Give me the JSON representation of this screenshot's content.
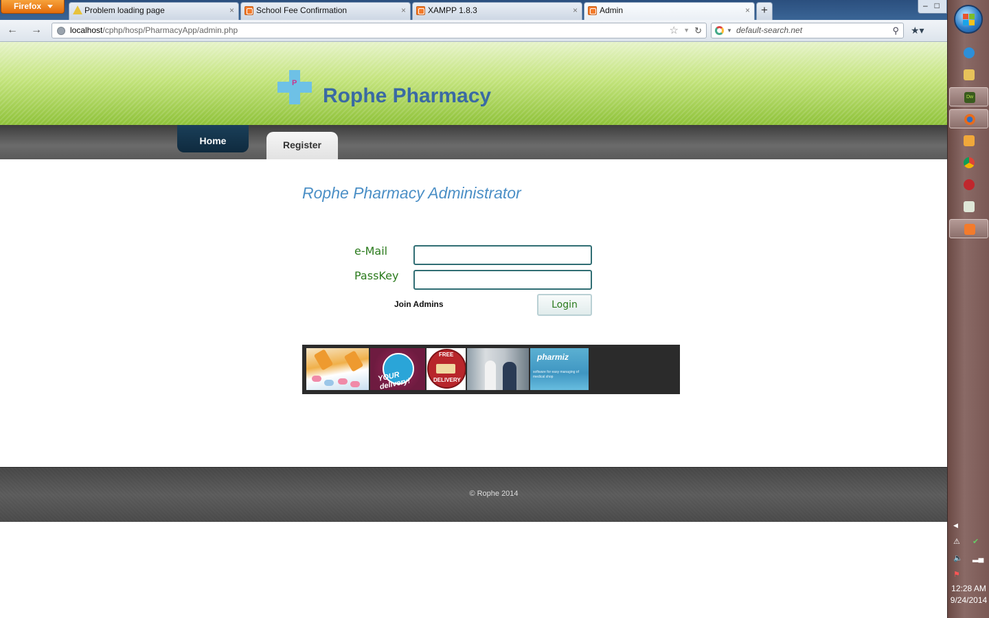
{
  "browser": {
    "menu_button": "Firefox",
    "tabs": [
      {
        "title": "Problem loading page",
        "icon": "warning-icon"
      },
      {
        "title": "School Fee Confirmation",
        "icon": "xampp-icon"
      },
      {
        "title": "XAMPP 1.8.3",
        "icon": "xampp-icon"
      },
      {
        "title": "Admin",
        "icon": "xampp-icon",
        "active": true
      }
    ],
    "new_tab": "+",
    "close_glyph": "×",
    "back": "←",
    "forward": "→",
    "url_host": "localhost",
    "url_path": "/cphp/hosp/PharmacyApp/admin.php",
    "search_placeholder": "default-search.net",
    "window_controls": "–□"
  },
  "site": {
    "logo_letter": "P",
    "title": "Rophe Pharmacy",
    "nav": {
      "home": "Home",
      "register": "Register"
    },
    "admin_title": "Rophe Pharmacy Administrator",
    "form": {
      "email_label": "e-Mail",
      "passkey_label": "PassKey",
      "email_value": "",
      "passkey_value": "",
      "join_link": "Join Admins",
      "login_button": "Login"
    },
    "gallery": {
      "delivery_badge": "YOUR delivery!",
      "free_top": "FREE",
      "free_bottom": "DELIVERY",
      "pharmiz_brand": "pharmiz",
      "pharmiz_tagline": "software for easy managing of medical shop"
    },
    "footer": "© Rophe 2014"
  },
  "taskbar": {
    "time": "12:28 AM",
    "date": "9/24/2014",
    "pinned": [
      "internet-explorer-icon",
      "file-explorer-icon",
      "dreamweaver-icon",
      "firefox-icon",
      "media-player-icon",
      "chrome-icon",
      "filezilla-icon",
      "task-manager-icon",
      "xampp-icon"
    ]
  },
  "colors": {
    "header_green": "#8fc23a",
    "title_blue": "#3a6aa3",
    "label_green": "#2a7a1c",
    "home_tab": "#0f2a3e"
  }
}
